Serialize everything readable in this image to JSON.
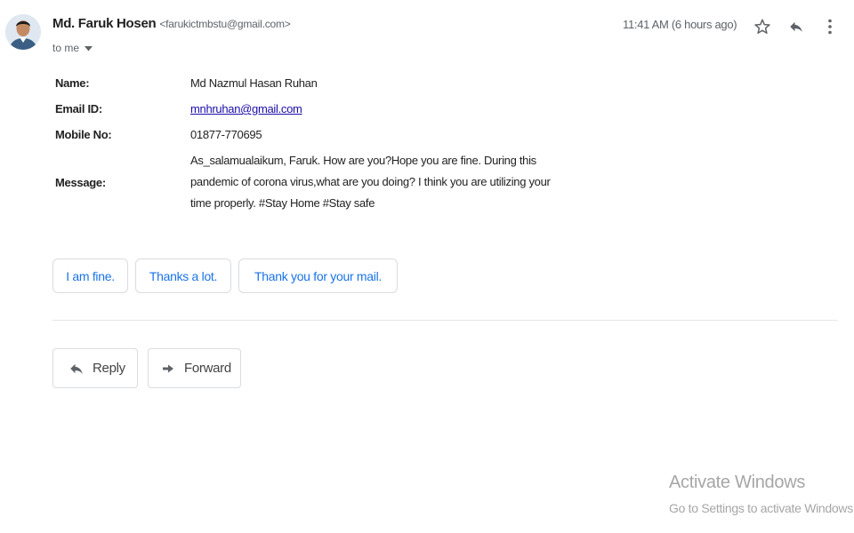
{
  "header": {
    "sender_name": "Md. Faruk Hosen",
    "sender_email": "<farukictmbstu@gmail.com>",
    "to_label": "to me",
    "timestamp": "11:41 AM (6 hours ago)",
    "icons": [
      "avatar",
      "chevron-down-icon",
      "star-icon",
      "reply-icon",
      "more-vert-icon"
    ]
  },
  "body": {
    "name_label": "Name:",
    "name_value": "Md Nazmul Hasan Ruhan",
    "email_label": "Email ID:",
    "email_value": "mnhruhan@gmail.com",
    "mobile_label": "Mobile No:",
    "mobile_value": "01877-770695",
    "message_label": "Message:",
    "message_value": "As_salamualaikum, Faruk. How are you?Hope you are fine. During this pandemic of corona virus,what are you doing? I think you are utilizing your time properly. #Stay Home #Stay safe"
  },
  "smart_replies": [
    "I am fine.",
    "Thanks a lot.",
    "Thank you for your mail."
  ],
  "actions": {
    "reply_label": "Reply",
    "forward_label": "Forward"
  },
  "watermark": {
    "title": "Activate Windows",
    "subtitle": "Go to Settings to activate Windows."
  },
  "colors": {
    "link": "#1a0dab",
    "chip_text": "#1a73e8",
    "border": "#dadce0",
    "muted": "#5f6368"
  }
}
